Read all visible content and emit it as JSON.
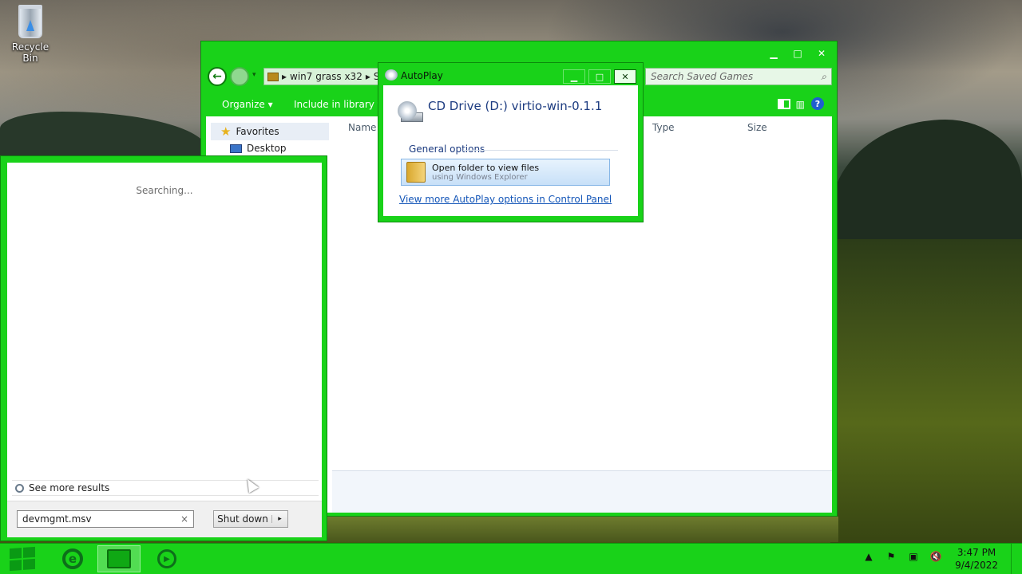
{
  "desktop": {
    "recycle_bin_label": "Recycle Bin"
  },
  "explorer": {
    "breadcrumb": [
      "win7 grass x32",
      "S"
    ],
    "search_placeholder": "Search Saved Games",
    "toolbar": {
      "organize": "Organize",
      "include_in_library": "Include in library"
    },
    "nav": {
      "favorites": "Favorites",
      "desktop": "Desktop"
    },
    "columns": {
      "name": "Name",
      "type": "Type",
      "size": "Size"
    }
  },
  "autoplay": {
    "title": "AutoPlay",
    "drive_title": "CD Drive (D:) virtio-win-0.1.1",
    "general_options": "General options",
    "option_title": "Open folder to view files",
    "option_subtitle": "using Windows Explorer",
    "more_link": "View more AutoPlay options in Control Panel"
  },
  "start_menu": {
    "status": "Searching...",
    "see_more": "See more results",
    "search_value": "devmgmt.msv",
    "clear_glyph": "×",
    "shutdown_label": "Shut down",
    "shutdown_arrow": "▸"
  },
  "taskbar": {
    "time": "3:47 PM",
    "date": "9/4/2022"
  },
  "glyphs": {
    "minimize": "▁",
    "maximize": "□",
    "close": "✕",
    "back": "←",
    "help": "?",
    "dropdown": "▾",
    "chevron": "▸",
    "tray_up": "▲",
    "flag": "⚑",
    "volume_muted": "🔇"
  },
  "colors": {
    "window_chrome": "#19d219",
    "taskbar": "#19d219",
    "link": "#1456b8"
  }
}
